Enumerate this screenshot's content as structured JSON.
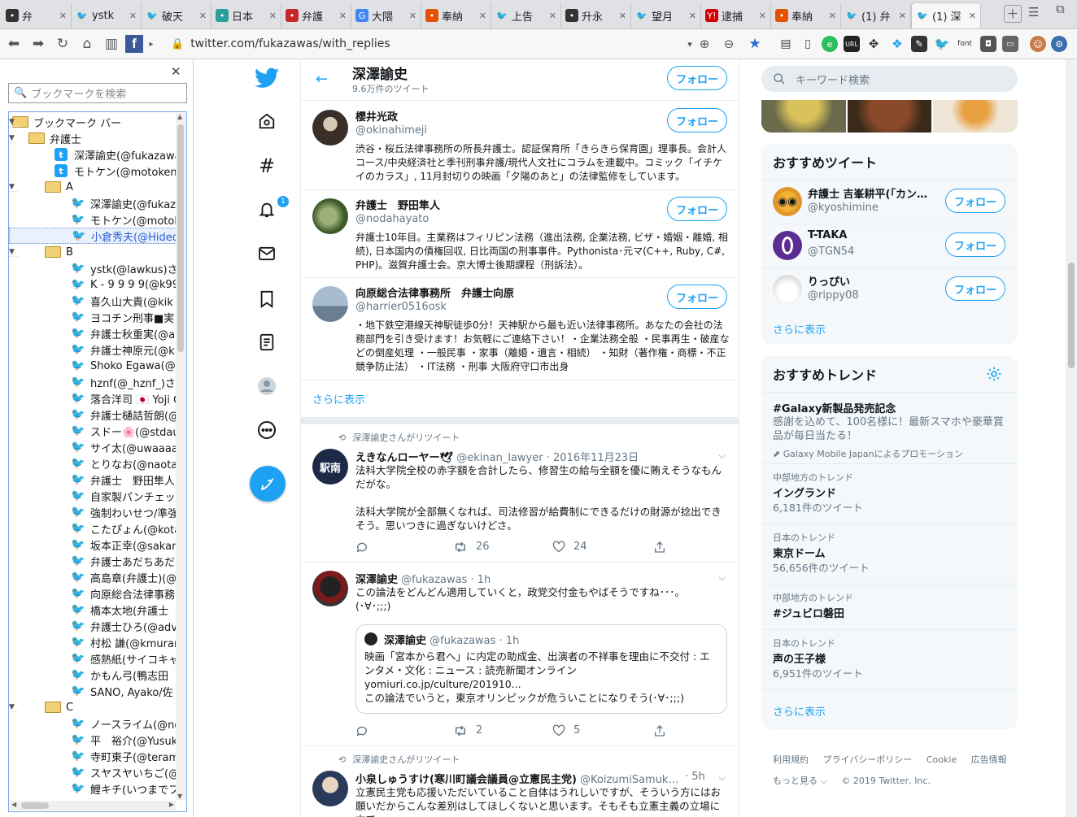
{
  "browser": {
    "tabs": [
      {
        "label": "弁",
        "icon": "panda-icon",
        "color": "#333333"
      },
      {
        "label": "ystk",
        "icon": "twitter-icon",
        "color": "#1da1f2"
      },
      {
        "label": "破天",
        "icon": "twitter-icon",
        "color": "#1da1f2"
      },
      {
        "label": "日本",
        "icon": "globe-icon",
        "color": "#2aa198"
      },
      {
        "label": "弁護",
        "icon": "red-box-icon",
        "color": "#c62828"
      },
      {
        "label": "大隈",
        "icon": "google-icon",
        "color": "#4285f4"
      },
      {
        "label": "奉納",
        "icon": "blog-icon",
        "color": "#e65100"
      },
      {
        "label": "上告",
        "icon": "twitter-icon",
        "color": "#1da1f2"
      },
      {
        "label": "升永",
        "icon": "github-icon",
        "color": "#333333"
      },
      {
        "label": "望月",
        "icon": "twitter-icon",
        "color": "#1da1f2"
      },
      {
        "label": "逮捕",
        "icon": "yahoo-icon",
        "color": "#d50000"
      },
      {
        "label": "奉納",
        "icon": "blog-icon",
        "color": "#e65100"
      },
      {
        "label": "(1) 弁",
        "icon": "twitter-icon",
        "color": "#1da1f2"
      },
      {
        "label": "(1) 深",
        "icon": "twitter-icon",
        "color": "#1da1f2"
      }
    ],
    "url": "twitter.com/fukazawas/with_replies",
    "ext_url_label": "URL",
    "ext_font_label": "font"
  },
  "sidebar": {
    "search_placeholder": "ブックマークを検索",
    "rows": [
      {
        "label": "ブックマーク バー",
        "kind": "folder",
        "level": 0,
        "open": true
      },
      {
        "label": "弁護士",
        "kind": "folder",
        "level": 1,
        "open": true
      },
      {
        "label": "深澤諭史(@fukazawas",
        "kind": "tbox",
        "level": 2
      },
      {
        "label": "モトケン(@motoken_",
        "kind": "tbox",
        "level": 2
      },
      {
        "label": "A",
        "kind": "folder",
        "level": 2,
        "open": true
      },
      {
        "label": "深澤諭史(@fukaz",
        "kind": "bird",
        "level": 3
      },
      {
        "label": "モトケン(@motoke",
        "kind": "bird",
        "level": 3
      },
      {
        "label": "小倉秀夫(@Hided",
        "kind": "bird",
        "level": 3,
        "selected": true
      },
      {
        "label": "B",
        "kind": "folder",
        "level": 2,
        "open": true
      },
      {
        "label": "ystk(@lawkus)さん",
        "kind": "bird",
        "level": 3
      },
      {
        "label": "K - 9 9 9 9(@k99",
        "kind": "bird",
        "level": 3
      },
      {
        "label": "喜久山大貴(@kik",
        "kind": "bird",
        "level": 3
      },
      {
        "label": "ヨコチン刑事■実",
        "kind": "bird",
        "level": 3
      },
      {
        "label": "弁護士秋重実(@a",
        "kind": "bird",
        "level": 3
      },
      {
        "label": "弁護士神原元(@k",
        "kind": "bird",
        "level": 3
      },
      {
        "label": "Shoko Egawa(@e",
        "kind": "bird",
        "level": 3
      },
      {
        "label": "hznf(@_hznf_)さん",
        "kind": "bird",
        "level": 3
      },
      {
        "label": "落合洋司 🇯🇵 Yoji O",
        "kind": "bird",
        "level": 3
      },
      {
        "label": "弁護士樋詰哲朗(@",
        "kind": "bird",
        "level": 3
      },
      {
        "label": "スドー🌸(@stdau",
        "kind": "bird",
        "level": 3
      },
      {
        "label": "サイ太(@uwaaaa)",
        "kind": "bird",
        "level": 3
      },
      {
        "label": "とりなお(@naotar",
        "kind": "bird",
        "level": 3
      },
      {
        "label": "弁護士　野田隼人",
        "kind": "bird",
        "level": 3
      },
      {
        "label": "自家製パンチェッタ",
        "kind": "bird",
        "level": 3
      },
      {
        "label": "強制わいせつ/準強",
        "kind": "bird",
        "level": 3
      },
      {
        "label": "こたぴょん(@kotao",
        "kind": "bird",
        "level": 3
      },
      {
        "label": "坂本正幸(@sakam",
        "kind": "bird",
        "level": 3
      },
      {
        "label": "弁護士あだちあだ",
        "kind": "bird",
        "level": 3
      },
      {
        "label": "高島章(弁護士)(@",
        "kind": "bird",
        "level": 3
      },
      {
        "label": "向原総合法律事務",
        "kind": "bird",
        "level": 3
      },
      {
        "label": "橋本太地(弁護士",
        "kind": "bird",
        "level": 3
      },
      {
        "label": "弁護士ひろ(@adv",
        "kind": "bird",
        "level": 3
      },
      {
        "label": "村松 謙(@kmurar",
        "kind": "bird",
        "level": 3
      },
      {
        "label": "感熱紙(サイコキャ",
        "kind": "bird",
        "level": 3
      },
      {
        "label": "かもん弓(鴨志田",
        "kind": "bird",
        "level": 3
      },
      {
        "label": "SANO, Ayako/佐",
        "kind": "bird",
        "level": 3
      },
      {
        "label": "C",
        "kind": "folder",
        "level": 2,
        "open": true
      },
      {
        "label": "ノースライム(@noo",
        "kind": "bird",
        "level": 3
      },
      {
        "label": "平　裕介(@Yusuk",
        "kind": "bird",
        "level": 3
      },
      {
        "label": "寺町東子(@teram",
        "kind": "bird",
        "level": 3
      },
      {
        "label": "スヤスヤいちご(@",
        "kind": "bird",
        "level": 3
      },
      {
        "label": "鯉キチ(いつまでフ",
        "kind": "bird",
        "level": 3
      }
    ]
  },
  "nav": {
    "notification_count": "1"
  },
  "profile": {
    "name": "深澤諭史",
    "tweet_count": "9.6万件のツイート",
    "follow_label": "フォロー"
  },
  "users": [
    {
      "name": "櫻井光政",
      "handle": "@okinahimeji",
      "bio": "渋谷・桜丘法律事務所の所長弁護士。認証保育所「きらきら保育園」理事長。会計人コース/中央経済社と季刊刑事弁護/現代人文社にコラムを連載中。コミック「イチケイのカラス」, 11月封切りの映画「夕陽のあと」の法律監修をしています。",
      "follow_label": "フォロー"
    },
    {
      "name": "弁護士　野田隼人",
      "handle": "@nodahayato",
      "bio": "弁護士10年目。主業務はフィリピン法務（進出法務, 企業法務, ビザ・婚姻・離婚, 相続), 日本国内の債権回収, 日比両国の刑事事件。Pythonista･元マ(C++, Ruby, C#, PHP)。滋賀弁護士会。京大博士後期課程（刑訴法）。",
      "follow_label": "フォロー"
    },
    {
      "name": "向原総合法律事務所　弁護士向原",
      "handle": "@harrier0516osk",
      "bio": "・地下鉄空港線天神駅徒歩0分！天神駅から最も近い法律事務所。あなたの会社の法務部門を引き受けます！お気軽にご連絡下さい！・企業法務全般 ・民事再生・破産などの倒産処理 ・一般民事 ・家事（離婚・遺言・相続） ・知財（著作権・商標・不正競争防止法） ・IT法務 ・刑事 大阪府守口市出身",
      "follow_label": "フォロー"
    }
  ],
  "show_more_label": "さらに表示",
  "tweets": [
    {
      "rt_label": "深澤諭史さんがリツイート",
      "name": "えきなんローヤー🕊",
      "handle": "@ekinan_lawyer",
      "time": "· 2016年11月23日",
      "body1": "法科大学院全校の赤字額を合計したら、修習生の給与全額を優に賄えそうなもんだがな。",
      "body2": "法科大学院が全部無くなれば、司法修習が給費制にできるだけの財源が捻出できそう。思いつきに過ぎないけどさ。",
      "retweets": "26",
      "likes": "24"
    },
    {
      "name": "深澤諭史",
      "handle": "@fukazawas",
      "time": "· 1h",
      "body1": "この論法をどんどん適用していくと，政党交付金もやばそうですね･･･。",
      "body2": "(･∀･;;;)",
      "quote_name": "深澤諭史",
      "quote_handle": "@fukazawas",
      "quote_time": "· 1h",
      "quote_body": "映画「宮本から君へ」に内定の助成金、出演者の不祥事を理由に不交付 : エンタメ・文化 : ニュース : 読売新聞オンライン",
      "quote_link": "yomiuri.co.jp/culture/201910...",
      "quote_body2": "この論法でいうと，東京オリンピックが危ういことになりそう(･∀･;;;)",
      "retweets": "2",
      "likes": "5"
    },
    {
      "rt_label": "深澤諭史さんがリツイート",
      "name": "小泉しゅうすけ(寒川町議会議員@立憲民主党)",
      "handle": "@KoizumiSamuk…",
      "time": "· 5h",
      "body1": "立憲民主党も応援いただいていること自体はうれしいですが、そういう方にはお願いだからこんな差別はしてほしくないと思います。そもそも立憲主義の立場に立て"
    }
  ],
  "right": {
    "search_placeholder": "キーワード検索",
    "rec_title": "おすすめツイート",
    "suggestions": [
      {
        "name": "弁護士 吉峯耕平(「カン…",
        "handle": "@kyoshimine",
        "follow_label": "フォロー",
        "avatar": "glasses-face-avatar"
      },
      {
        "name": "T-TAKA",
        "handle": "@TGN54",
        "follow_label": "フォロー",
        "avatar": "purple-ring-avatar"
      },
      {
        "name": "りっぴい",
        "handle": "@rippy08",
        "follow_label": "フォロー",
        "avatar": "white-cat-avatar"
      }
    ],
    "show_more_label": "さらに表示",
    "trends_title": "おすすめトレンド",
    "promo": {
      "tag": "#Galaxy新製品発売記念",
      "text": "感謝を込めて、100名様に！最新スマホや豪華賞品が毎日当たる！",
      "by": "Galaxy Mobile Japanによるプロモーション"
    },
    "trends": [
      {
        "context": "中部地方のトレンド",
        "name": "イングランド",
        "count": "6,181件のツイート"
      },
      {
        "context": "日本のトレンド",
        "name": "東京ドーム",
        "count": "56,656件のツイート"
      },
      {
        "context": "中部地方のトレンド",
        "name": "#ジュビロ磐田",
        "count": ""
      },
      {
        "context": "日本のトレンド",
        "name": "声の王子様",
        "count": "6,951件のツイート"
      }
    ],
    "trends_more": "さらに表示",
    "footer": {
      "terms": "利用規約",
      "privacy": "プライバシーポリシー",
      "cookie": "Cookie",
      "ads": "広告情報",
      "more": "もっと見る ⌵",
      "copyright": "© 2019 Twitter, Inc."
    }
  },
  "colors": {
    "twitter_blue": "#1da1f2",
    "text_secondary": "#657786",
    "border": "#e6ecf0"
  }
}
